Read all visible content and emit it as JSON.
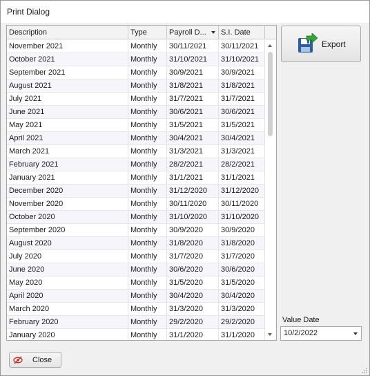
{
  "window": {
    "title": "Print Dialog"
  },
  "grid": {
    "columns": [
      "Description",
      "Type",
      "Payroll D...",
      "S.I. Date"
    ],
    "sort_column": "Payroll D...",
    "rows": [
      [
        "November 2021",
        "Monthly",
        "30/11/2021",
        "30/11/2021"
      ],
      [
        "October 2021",
        "Monthly",
        "31/10/2021",
        "31/10/2021"
      ],
      [
        "September 2021",
        "Monthly",
        "30/9/2021",
        "30/9/2021"
      ],
      [
        "August 2021",
        "Monthly",
        "31/8/2021",
        "31/8/2021"
      ],
      [
        "July 2021",
        "Monthly",
        "31/7/2021",
        "31/7/2021"
      ],
      [
        "June 2021",
        "Monthly",
        "30/6/2021",
        "30/6/2021"
      ],
      [
        "May 2021",
        "Monthly",
        "31/5/2021",
        "31/5/2021"
      ],
      [
        "April 2021",
        "Monthly",
        "30/4/2021",
        "30/4/2021"
      ],
      [
        "March 2021",
        "Monthly",
        "31/3/2021",
        "31/3/2021"
      ],
      [
        "February 2021",
        "Monthly",
        "28/2/2021",
        "28/2/2021"
      ],
      [
        "January 2021",
        "Monthly",
        "31/1/2021",
        "31/1/2021"
      ],
      [
        "December 2020",
        "Monthly",
        "31/12/2020",
        "31/12/2020"
      ],
      [
        "November 2020",
        "Monthly",
        "30/11/2020",
        "30/11/2020"
      ],
      [
        "October 2020",
        "Monthly",
        "31/10/2020",
        "31/10/2020"
      ],
      [
        "September 2020",
        "Monthly",
        "30/9/2020",
        "30/9/2020"
      ],
      [
        "August 2020",
        "Monthly",
        "31/8/2020",
        "31/8/2020"
      ],
      [
        "July 2020",
        "Monthly",
        "31/7/2020",
        "31/7/2020"
      ],
      [
        "June 2020",
        "Monthly",
        "30/6/2020",
        "30/6/2020"
      ],
      [
        "May 2020",
        "Monthly",
        "31/5/2020",
        "31/5/2020"
      ],
      [
        "April 2020",
        "Monthly",
        "30/4/2020",
        "30/4/2020"
      ],
      [
        "March 2020",
        "Monthly",
        "31/3/2020",
        "31/3/2020"
      ],
      [
        "February 2020",
        "Monthly",
        "29/2/2020",
        "29/2/2020"
      ],
      [
        "January 2020",
        "Monthly",
        "31/1/2020",
        "31/1/2020"
      ]
    ]
  },
  "export": {
    "label": "Export",
    "icon": "floppy-disk-export-icon"
  },
  "value_date": {
    "label": "Value Date",
    "value": "10/2/2022"
  },
  "close": {
    "label": "Close",
    "icon": "close-eye-icon"
  },
  "colors": {
    "alt_row": "#f6f5fb",
    "border": "#a8a8a8",
    "button_top": "#f6f6f6",
    "button_bottom": "#e4e4e4",
    "floppy_blue": "#2c5d9e",
    "arrow_green": "#3aa23a",
    "close_red": "#cc2a2a"
  }
}
